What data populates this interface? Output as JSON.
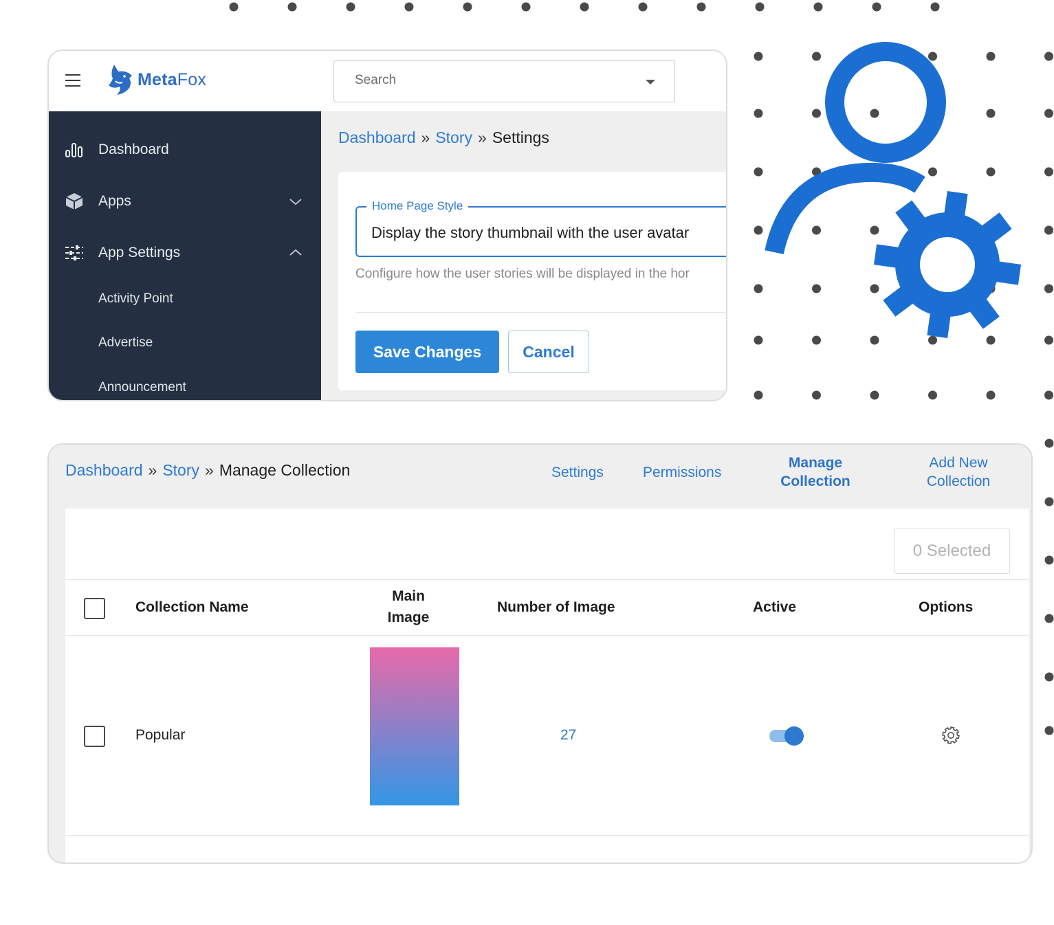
{
  "colors": {
    "accent": "#2e7ad1",
    "sidebar": "#243042",
    "illustration": "#1c6fd2"
  },
  "header": {
    "logo": {
      "brand_bold": "Meta",
      "brand_light": "Fox"
    },
    "search": {
      "placeholder": "Search"
    }
  },
  "sidebar": {
    "items": [
      {
        "label": "Dashboard",
        "icon": "bar-chart-icon"
      },
      {
        "label": "Apps",
        "icon": "cube-icon",
        "expandable": true
      },
      {
        "label": "App Settings",
        "icon": "sliders-icon",
        "expanded": true
      }
    ],
    "subitems": [
      "Activity Point",
      "Advertise",
      "Announcement"
    ]
  },
  "settings_page": {
    "breadcrumb": [
      "Dashboard",
      "Story",
      "Settings"
    ],
    "breadcrumb_sep": "»",
    "field": {
      "legend": "Home Page Style",
      "value": "Display the story thumbnail with the user avatar",
      "helper": "Configure how the user stories will be displayed in the hor"
    },
    "save_label": "Save Changes",
    "cancel_label": "Cancel"
  },
  "collection_page": {
    "breadcrumb": [
      "Dashboard",
      "Story",
      "Manage Collection"
    ],
    "breadcrumb_sep": "»",
    "tabs": [
      {
        "label": "Settings"
      },
      {
        "label": "Permissions"
      },
      {
        "label": "Manage Collection",
        "active": true
      },
      {
        "label": "Add New Collection"
      }
    ],
    "selected_label": "0 Selected",
    "columns": [
      "Collection Name",
      "Main Image",
      "Number of Image",
      "Active",
      "Options"
    ],
    "rows": [
      {
        "name": "Popular",
        "image_count": "27",
        "active": true,
        "thumb_colors": [
          "#e86aa9",
          "#3396e6"
        ]
      }
    ]
  }
}
